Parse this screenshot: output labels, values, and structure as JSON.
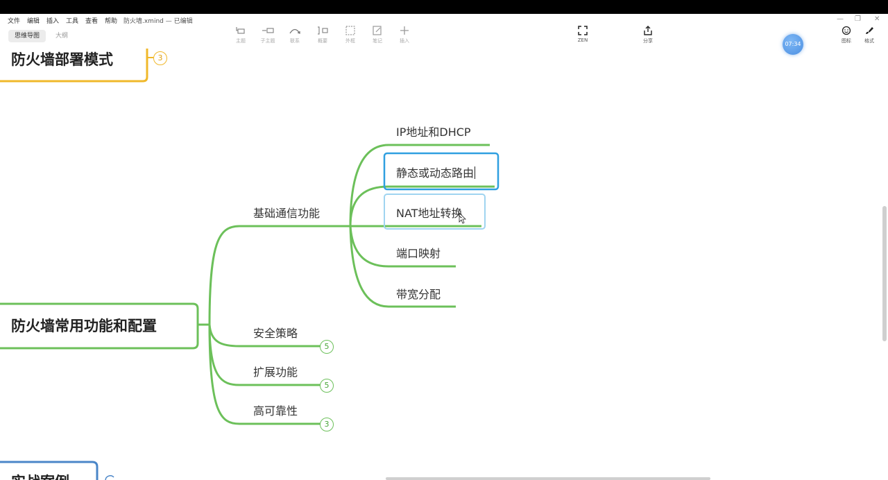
{
  "menu": [
    "文件",
    "编辑",
    "插入",
    "工具",
    "查看",
    "帮助"
  ],
  "doc_title": "防火墙.xmind — 已编辑",
  "window_controls": [
    "—",
    "❐",
    "✕"
  ],
  "view_tabs": {
    "mindmap": "思维导图",
    "outline": "大纲"
  },
  "toolbar": {
    "topic": "主题",
    "subtopic": "子主题",
    "relationship": "联系",
    "summary": "概要",
    "boundary": "外框",
    "note": "笔记",
    "insert": "插入",
    "zen": "ZEN",
    "share": "分享",
    "icons": "图标",
    "style": "格式"
  },
  "timer": "07:34",
  "mindmap": {
    "top_topic": {
      "title": "防火墙部署模式",
      "count": "3"
    },
    "main_topic": {
      "title": "防火墙常用功能和配置",
      "subtopics": [
        {
          "title": "基础通信功能",
          "children": [
            "IP地址和DHCP",
            "静态或动态路由",
            "NAT地址转换",
            "端口映射",
            "带宽分配"
          ]
        },
        {
          "title": "安全策略",
          "count": "5"
        },
        {
          "title": "扩展功能",
          "count": "5"
        },
        {
          "title": "高可靠性",
          "count": "3"
        }
      ]
    },
    "bottom_topic": {
      "title": "实战案例"
    }
  },
  "colors": {
    "branch_green": "#6cc05a",
    "branch_yellow": "#f0b82a",
    "branch_blue": "#4a86c8",
    "selection_blue": "#2f9fe0",
    "hover_blue": "#9fd4f0"
  }
}
